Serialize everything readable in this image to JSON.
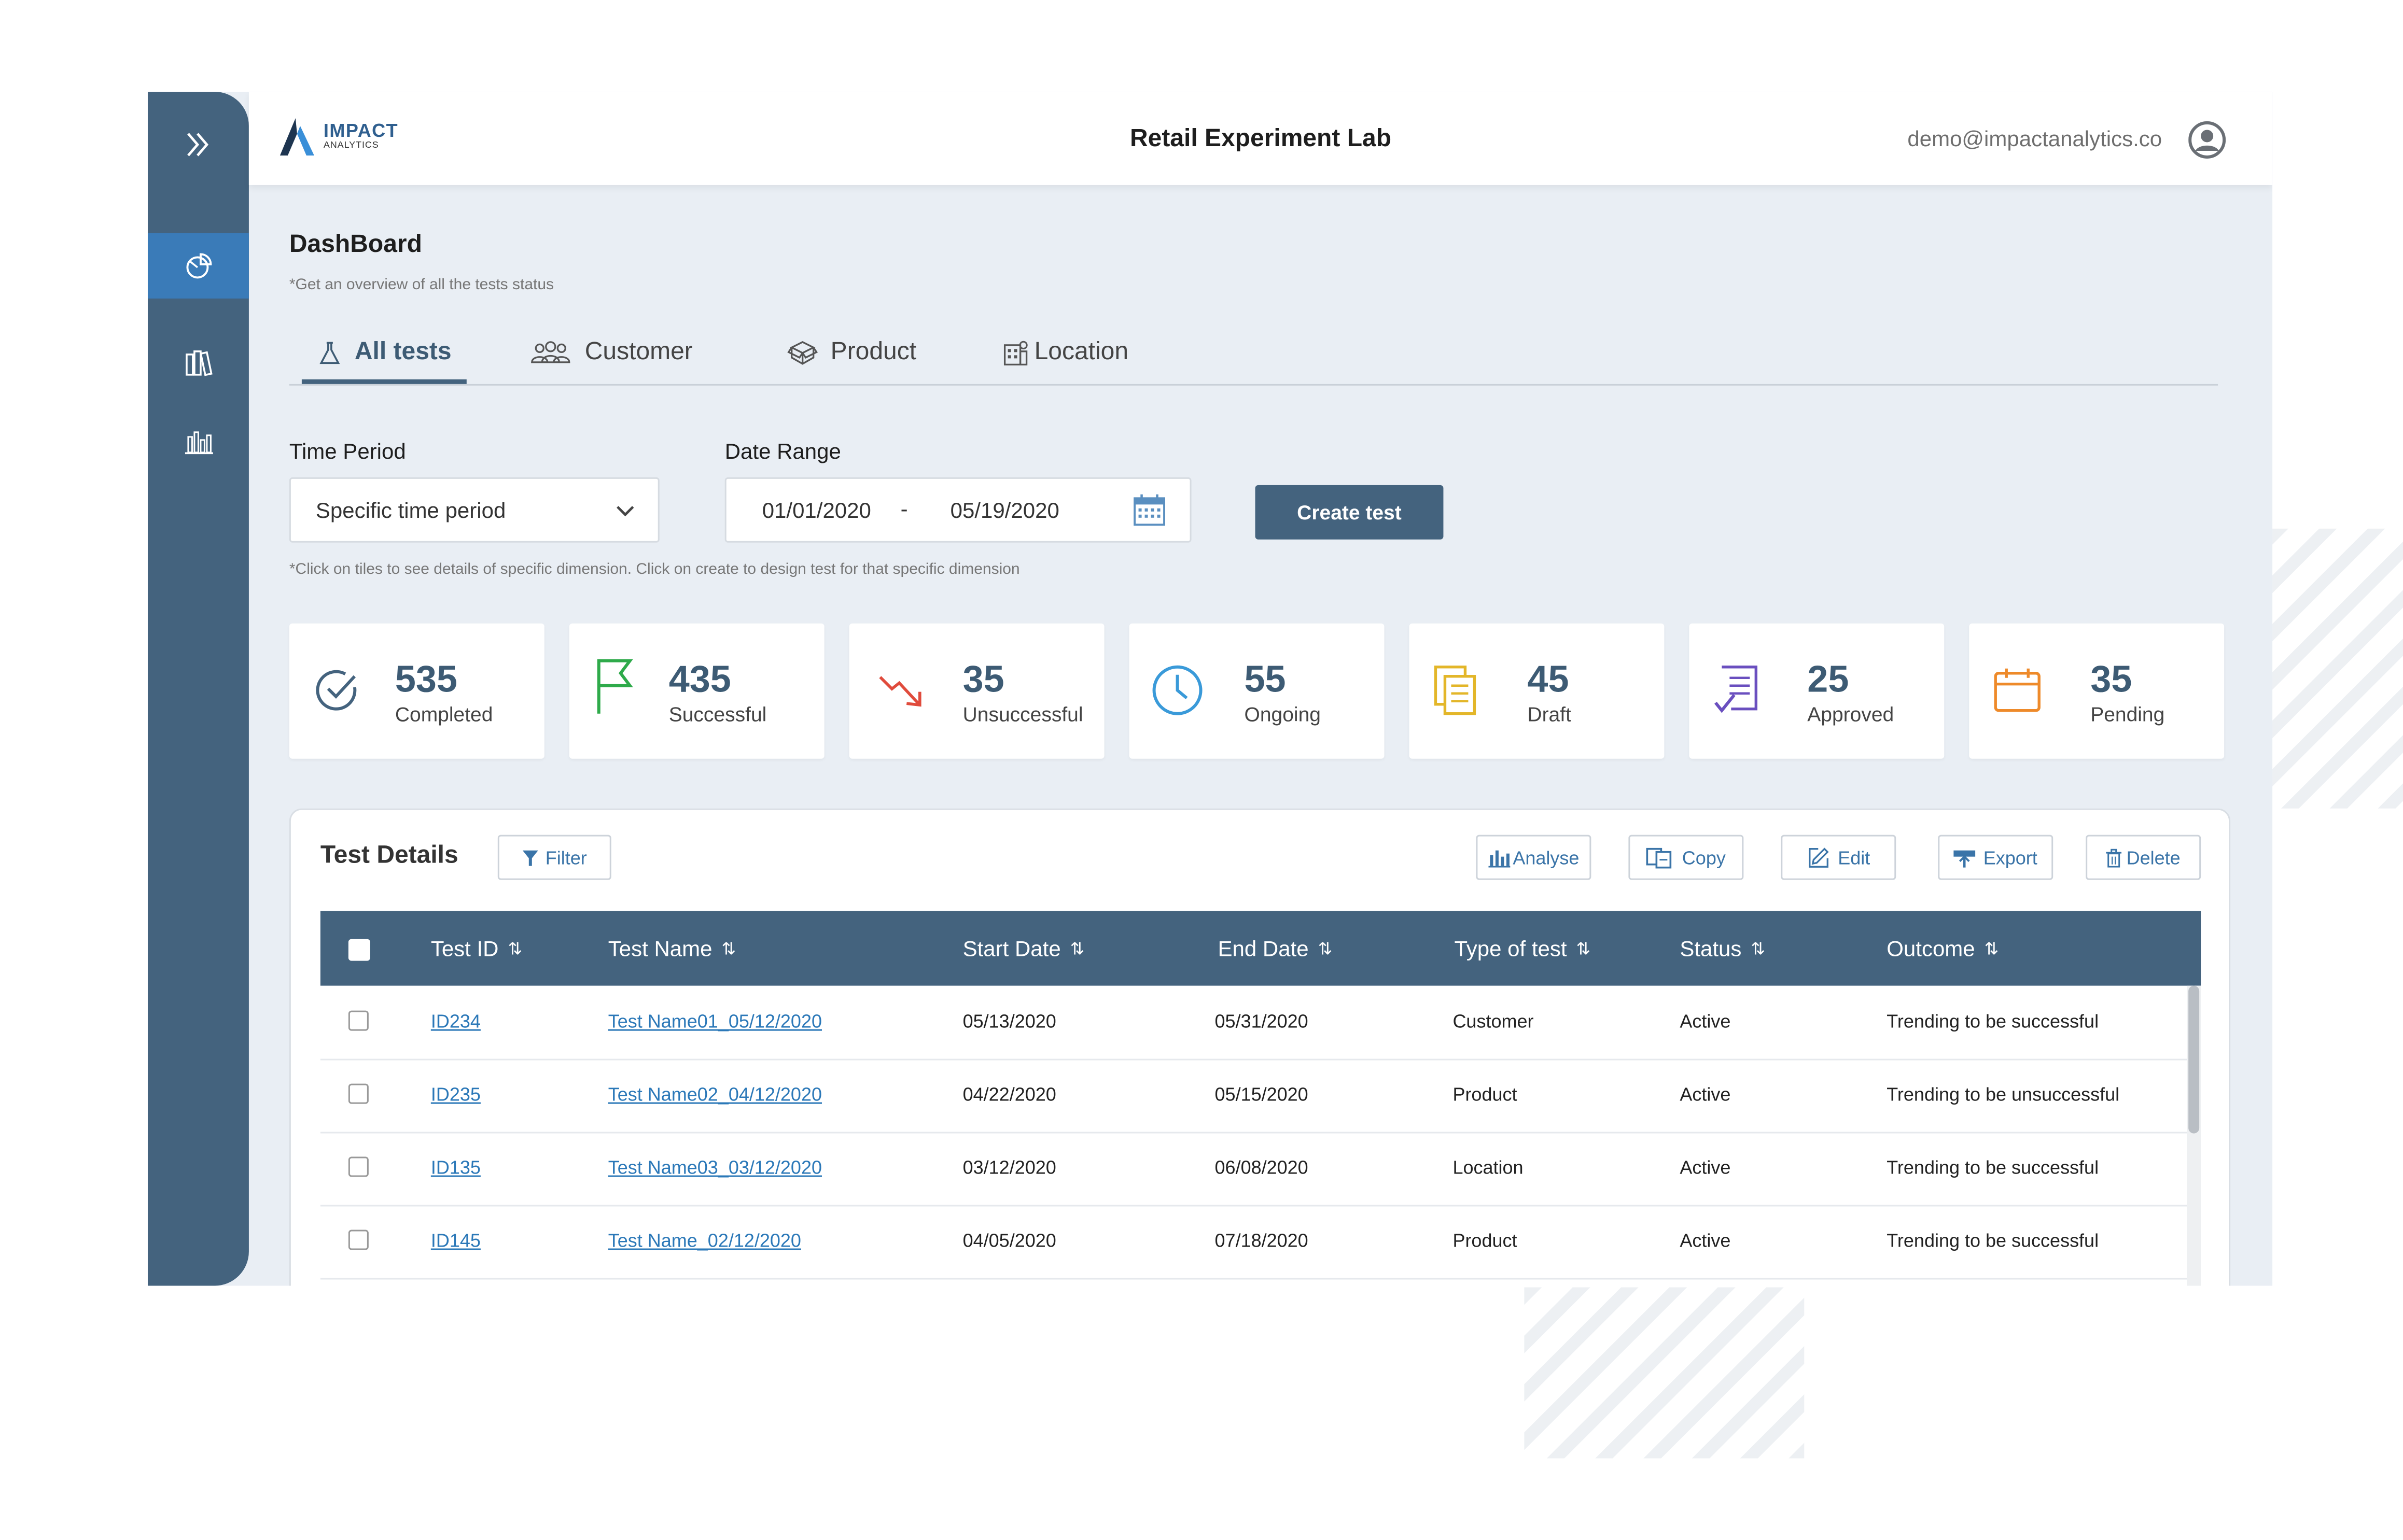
{
  "header": {
    "logo_title": "IMPACT",
    "logo_subtitle": "ANALYTICS",
    "app_title": "Retail Experiment Lab",
    "user_email": "demo@impactanalytics.co"
  },
  "sidebar": {
    "items": [
      {
        "icon": "double-chevron-right-icon"
      },
      {
        "icon": "pie-chart-icon",
        "active": true
      },
      {
        "icon": "books-icon"
      },
      {
        "icon": "bar-chart-icon"
      }
    ]
  },
  "page": {
    "title": "DashBoard",
    "subtitle": "*Get an overview of all the tests status",
    "hint": "*Click on tiles to see details of specific dimension.  Click on create to design test for that specific dimension"
  },
  "tabs": [
    {
      "label": "All tests",
      "icon": "flask-icon",
      "active": true
    },
    {
      "label": "Customer",
      "icon": "group-icon"
    },
    {
      "label": "Product",
      "icon": "box-icon"
    },
    {
      "label": "Location",
      "icon": "building-icon"
    }
  ],
  "filters": {
    "time_period_label": "Time Period",
    "time_period_value": "Specific time period",
    "date_range_label": "Date Range",
    "date_from": "01/01/2020",
    "date_separator": "-",
    "date_to": "05/19/2020",
    "create_button": "Create test"
  },
  "tiles": [
    {
      "value": "535",
      "label": "Completed",
      "icon": "check-circle-icon",
      "color": "#44637e"
    },
    {
      "value": "435",
      "label": "Successful",
      "icon": "flag-icon",
      "color": "#2eaa4a"
    },
    {
      "value": "35",
      "label": "Unsuccessful",
      "icon": "trend-down-icon",
      "color": "#e04b3c"
    },
    {
      "value": "55",
      "label": "Ongoing",
      "icon": "clock-icon",
      "color": "#3a9ad9"
    },
    {
      "value": "45",
      "label": "Draft",
      "icon": "documents-icon",
      "color": "#e3b629"
    },
    {
      "value": "25",
      "label": "Approved",
      "icon": "approved-doc-icon",
      "color": "#6a4fbf"
    },
    {
      "value": "35",
      "label": "Pending",
      "icon": "calendar-icon",
      "color": "#ee8a2a"
    }
  ],
  "test_details": {
    "title": "Test Details",
    "filter_label": "Filter",
    "actions": {
      "analyse": "Analyse",
      "copy": "Copy",
      "edit": "Edit",
      "export": "Export",
      "delete": "Delete"
    },
    "columns": [
      "Test ID",
      "Test Name",
      "Start Date",
      "End Date",
      "Type of test",
      "Status",
      "Outcome"
    ],
    "rows": [
      {
        "id": "ID234",
        "name": "Test Name01_05/12/2020",
        "start": "05/13/2020",
        "end": "05/31/2020",
        "type": "Customer",
        "status": "Active",
        "outcome": "Trending to be successful"
      },
      {
        "id": "ID235",
        "name": "Test Name02_04/12/2020",
        "start": "04/22/2020",
        "end": "05/15/2020",
        "type": "Product",
        "status": "Active",
        "outcome": "Trending to be unsuccessful"
      },
      {
        "id": "ID135",
        "name": "Test Name03_03/12/2020",
        "start": "03/12/2020",
        "end": "06/08/2020",
        "type": "Location",
        "status": "Active",
        "outcome": "Trending to be successful"
      },
      {
        "id": "ID145",
        "name": "Test Name_02/12/2020",
        "start": "04/05/2020",
        "end": "07/18/2020",
        "type": "Product",
        "status": "Active",
        "outcome": "Trending to be successful"
      }
    ]
  }
}
